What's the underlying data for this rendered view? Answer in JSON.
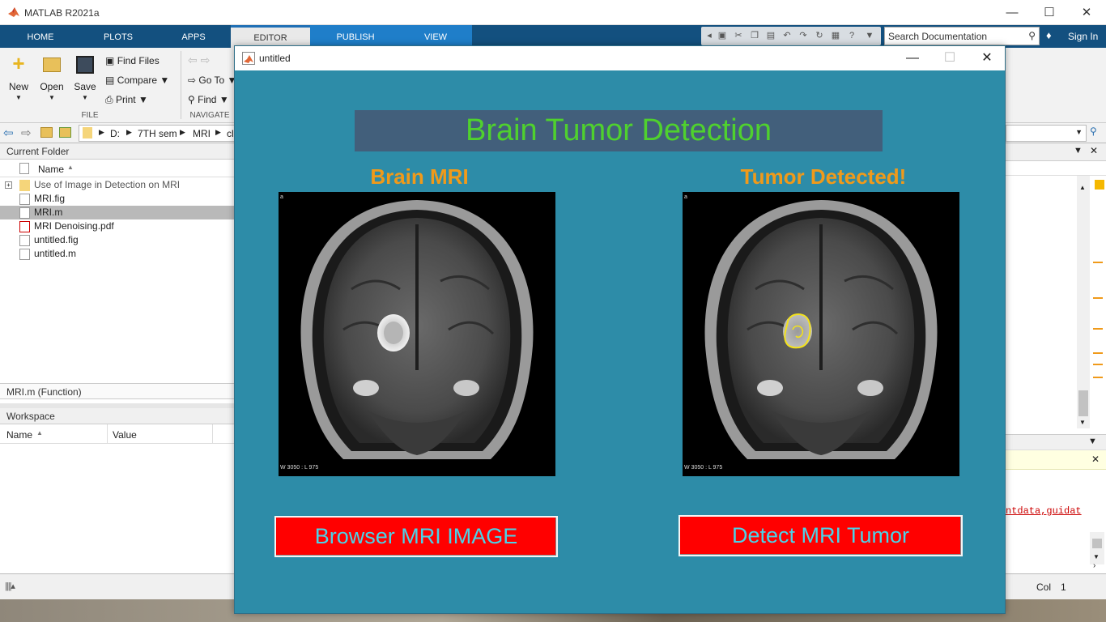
{
  "app": {
    "title": "MATLAB R2021a"
  },
  "tabs": [
    "HOME",
    "PLOTS",
    "APPS",
    "EDITOR",
    "PUBLISH",
    "VIEW"
  ],
  "search": {
    "placeholder": "Search Documentation"
  },
  "signin": "Sign In",
  "ribbon": {
    "new": "New",
    "open": "Open",
    "save": "Save",
    "find_files": "Find Files",
    "compare": "Compare",
    "print": "Print",
    "go_to": "Go To",
    "find": "Find",
    "group_file": "FILE",
    "group_navigate": "NAVIGATE"
  },
  "path": [
    "D:",
    "7TH sem",
    "MRI",
    "cl"
  ],
  "current_folder": {
    "title": "Current Folder",
    "col_name": "Name",
    "items": [
      {
        "name": "Use of Image in Detection on MRI",
        "type": "folder"
      },
      {
        "name": "MRI.fig",
        "type": "fig"
      },
      {
        "name": "MRI.m",
        "type": "m",
        "selected": true
      },
      {
        "name": "MRI Denoising.pdf",
        "type": "pdf"
      },
      {
        "name": "untitled.fig",
        "type": "fig"
      },
      {
        "name": "untitled.m",
        "type": "m"
      }
    ],
    "details": "MRI.m  (Function)"
  },
  "workspace": {
    "title": "Workspace",
    "col_name": "Name",
    "col_value": "Value"
  },
  "code_snippet": "ntdata,guidat",
  "status": {
    "col_label": "Col",
    "col_value": "1"
  },
  "figure": {
    "window_title": "untitled",
    "banner": "Brain Tumor Detection",
    "left_label": "Brain MRI",
    "right_label": "Tumor Detected!",
    "image_corner": "a",
    "image_footer": "W 3050 : L 975",
    "browse_button": "Browser MRI IMAGE",
    "detect_button": "Detect MRI Tumor"
  },
  "colors": {
    "figure_bg": "#2d8ca8",
    "banner_bg": "#425f7b",
    "banner_text": "#4fd12e",
    "label": "#f09a1a",
    "button_bg": "#ff0000",
    "button_text": "#4bd3e8"
  }
}
